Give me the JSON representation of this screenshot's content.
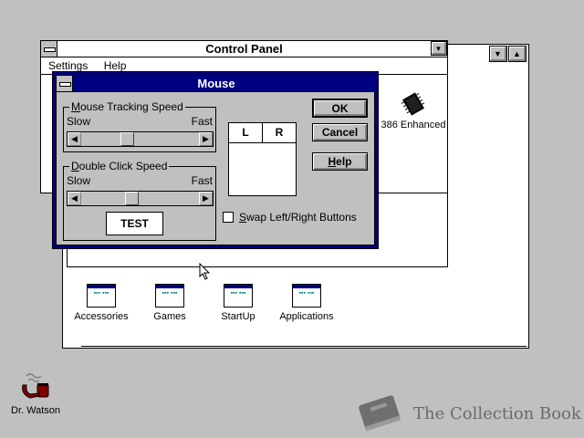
{
  "program_manager": {
    "groups": [
      {
        "label": "Accessories"
      },
      {
        "label": "Games"
      },
      {
        "label": "StartUp"
      },
      {
        "label": "Applications"
      }
    ]
  },
  "control_panel": {
    "title": "Control Panel",
    "menu": [
      "Settings",
      "Help"
    ],
    "icon_label": "386 Enhanced"
  },
  "mouse_dialog": {
    "title": "Mouse",
    "tracking_group": "Mouse Tracking Speed",
    "tracking_slow": "Slow",
    "tracking_fast": "Fast",
    "tracking_value": 0.38,
    "dblclick_group": "Double Click Speed",
    "dblclick_slow": "Slow",
    "dblclick_fast": "Fast",
    "dblclick_value": 0.42,
    "test_label": "TEST",
    "left_label": "L",
    "right_label": "R",
    "swap_label": "Swap Left/Right Buttons",
    "swap_checked": false,
    "ok_label": "OK",
    "cancel_label": "Cancel",
    "help_label": "Help"
  },
  "desktop": {
    "watson_label": "Dr. Watson",
    "watermark": "The Collection Book"
  }
}
